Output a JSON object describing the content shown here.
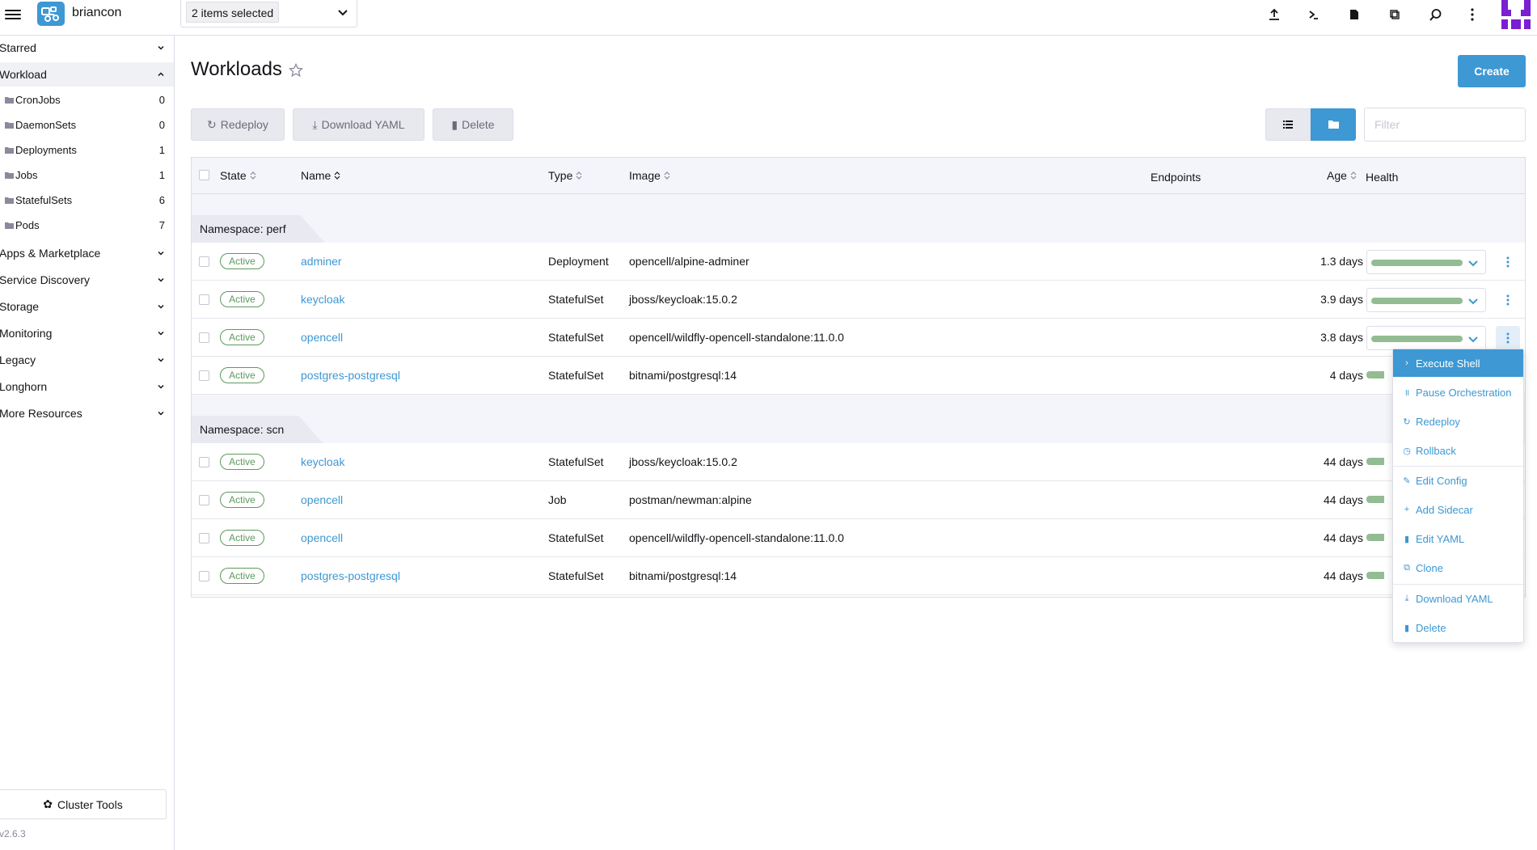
{
  "header": {
    "cluster_name": "briancon",
    "namespace_selector": "2 items selected",
    "icons": [
      "upload-icon",
      "shell-icon",
      "file-icon",
      "copy-icon",
      "search-icon",
      "more-vertical-icon"
    ]
  },
  "sidebar": {
    "groups": [
      {
        "label": "Starred"
      },
      {
        "label": "Workload"
      },
      {
        "label": "Apps & Marketplace"
      },
      {
        "label": "Service Discovery"
      },
      {
        "label": "Storage"
      },
      {
        "label": "Monitoring"
      },
      {
        "label": "Legacy"
      },
      {
        "label": "Longhorn"
      },
      {
        "label": "More Resources"
      }
    ],
    "workload_items": [
      {
        "label": "CronJobs",
        "count": "0"
      },
      {
        "label": "DaemonSets",
        "count": "0"
      },
      {
        "label": "Deployments",
        "count": "1"
      },
      {
        "label": "Jobs",
        "count": "1"
      },
      {
        "label": "StatefulSets",
        "count": "6"
      },
      {
        "label": "Pods",
        "count": "7"
      }
    ],
    "cluster_tools": "Cluster Tools",
    "version": "v2.6.3"
  },
  "main": {
    "title": "Workloads",
    "create_label": "Create",
    "bulk": {
      "redeploy": "Redeploy",
      "download": "Download YAML",
      "delete": "Delete"
    },
    "filter_placeholder": "Filter"
  },
  "table": {
    "headers": {
      "state": "State",
      "name": "Name",
      "type": "Type",
      "image": "Image",
      "endpoints": "Endpoints",
      "age": "Age",
      "health": "Health"
    },
    "groups": [
      {
        "label": "Namespace: perf",
        "rows": [
          {
            "state": "Active",
            "name": "adminer",
            "type": "Deployment",
            "image": "opencell/alpine-adminer",
            "age": "1.3 days"
          },
          {
            "state": "Active",
            "name": "keycloak",
            "type": "StatefulSet",
            "image": "jboss/keycloak:15.0.2",
            "age": "3.9 days"
          },
          {
            "state": "Active",
            "name": "opencell",
            "type": "StatefulSet",
            "image": "opencell/wildfly-opencell-standalone:11.0.0",
            "age": "3.8 days"
          },
          {
            "state": "Active",
            "name": "postgres-postgresql",
            "type": "StatefulSet",
            "image": "bitnami/postgresql:14",
            "age": "4 days"
          }
        ]
      },
      {
        "label": "Namespace: scn",
        "rows": [
          {
            "state": "Active",
            "name": "keycloak",
            "type": "StatefulSet",
            "image": "jboss/keycloak:15.0.2",
            "age": "44 days"
          },
          {
            "state": "Active",
            "name": "opencell",
            "type": "Job",
            "image": "postman/newman:alpine",
            "age": "44 days"
          },
          {
            "state": "Active",
            "name": "opencell",
            "type": "StatefulSet",
            "image": "opencell/wildfly-opencell-standalone:11.0.0",
            "age": "44 days"
          },
          {
            "state": "Active",
            "name": "postgres-postgresql",
            "type": "StatefulSet",
            "image": "bitnami/postgresql:14",
            "age": "44 days"
          }
        ]
      }
    ]
  },
  "context_menu": {
    "items": [
      {
        "label": "Execute Shell",
        "glyph": "›"
      },
      {
        "label": "Pause Orchestration",
        "glyph": "॥"
      },
      {
        "label": "Redeploy",
        "glyph": "↻"
      },
      {
        "label": "Rollback",
        "glyph": "◷"
      },
      {
        "label": "Edit Config",
        "glyph": "✎"
      },
      {
        "label": "Add Sidecar",
        "glyph": "+"
      },
      {
        "label": "Edit YAML",
        "glyph": "▮"
      },
      {
        "label": "Clone",
        "glyph": "⧉"
      },
      {
        "label": "Download YAML",
        "glyph": "⤓"
      },
      {
        "label": "Delete",
        "glyph": "▮"
      }
    ]
  },
  "colors": {
    "primary": "#3d98d3",
    "success": "#5d995d",
    "health_bar": "#93bc93",
    "avatar": "#7a1fd1"
  }
}
